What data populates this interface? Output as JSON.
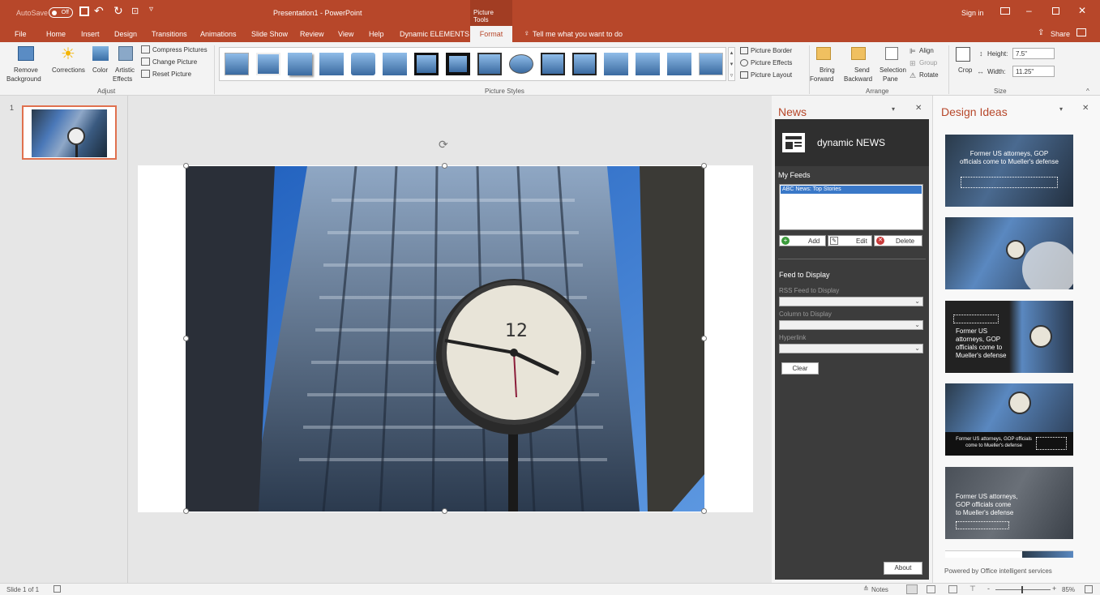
{
  "titlebar": {
    "autosave_label": "AutoSave",
    "autosave_state": "Off",
    "doc_title": "Presentation1  -  PowerPoint",
    "context_title": "Picture Tools",
    "signin": "Sign in"
  },
  "tabs": [
    {
      "label": "File"
    },
    {
      "label": "Home"
    },
    {
      "label": "Insert"
    },
    {
      "label": "Design"
    },
    {
      "label": "Transitions"
    },
    {
      "label": "Animations"
    },
    {
      "label": "Slide Show"
    },
    {
      "label": "Review"
    },
    {
      "label": "View"
    },
    {
      "label": "Help"
    },
    {
      "label": "Dynamic ELEMENTS"
    },
    {
      "label": "Format"
    }
  ],
  "tellme": "Tell me what you want to do",
  "share": "Share",
  "ribbon": {
    "remove_bg_1": "Remove",
    "remove_bg_2": "Background",
    "corrections": "Corrections",
    "color": "Color",
    "artistic_1": "Artistic",
    "artistic_2": "Effects",
    "compress": "Compress Pictures",
    "change": "Change Picture",
    "reset": "Reset Picture",
    "adjust_label": "Adjust",
    "styles_label": "Picture Styles",
    "border": "Picture Border",
    "effects": "Picture Effects",
    "layout": "Picture Layout",
    "bring_1": "Bring",
    "bring_2": "Forward",
    "send_1": "Send",
    "send_2": "Backward",
    "selection_1": "Selection",
    "selection_2": "Pane",
    "align": "Align",
    "group": "Group",
    "rotate": "Rotate",
    "arrange_label": "Arrange",
    "crop": "Crop",
    "height_label": "Height:",
    "height_value": "7.5\"",
    "width_label": "Width:",
    "width_value": "11.25\"",
    "size_label": "Size"
  },
  "slides": {
    "number": "1"
  },
  "news": {
    "title": "News",
    "brand": "dynamic NEWS",
    "my_feeds": "My Feeds",
    "feed_item": "ABC News: Top Stories",
    "add": "Add",
    "edit": "Edit",
    "delete": "Delete",
    "feed_to_display": "Feed to Display",
    "rss_label": "RSS Feed to Display",
    "column_label": "Column to Display",
    "hyperlink_label": "Hyperlink",
    "clear": "Clear",
    "about": "About"
  },
  "design": {
    "title": "Design Ideas",
    "thumb1": "Former US attorneys, GOP officials come to Mueller's defense",
    "thumb3_1": "Former US",
    "thumb3_2": "attorneys, GOP",
    "thumb3_3": "officials come to",
    "thumb3_4": "Mueller's defense",
    "thumb4": "Former US attorneys, GOP officials come to Mueller's defense",
    "thumb5_1": "Former US attorneys,",
    "thumb5_2": "GOP officials come",
    "thumb5_3": "to Mueller's defense",
    "powered": "Powered by Office intelligent services"
  },
  "status": {
    "slide_of": "Slide 1 of 1",
    "notes": "Notes",
    "zoom": "85%"
  },
  "colors": {
    "accent": "#b7472a",
    "news_bg": "#3c3c3c",
    "selected_feed": "#3a78c8"
  }
}
